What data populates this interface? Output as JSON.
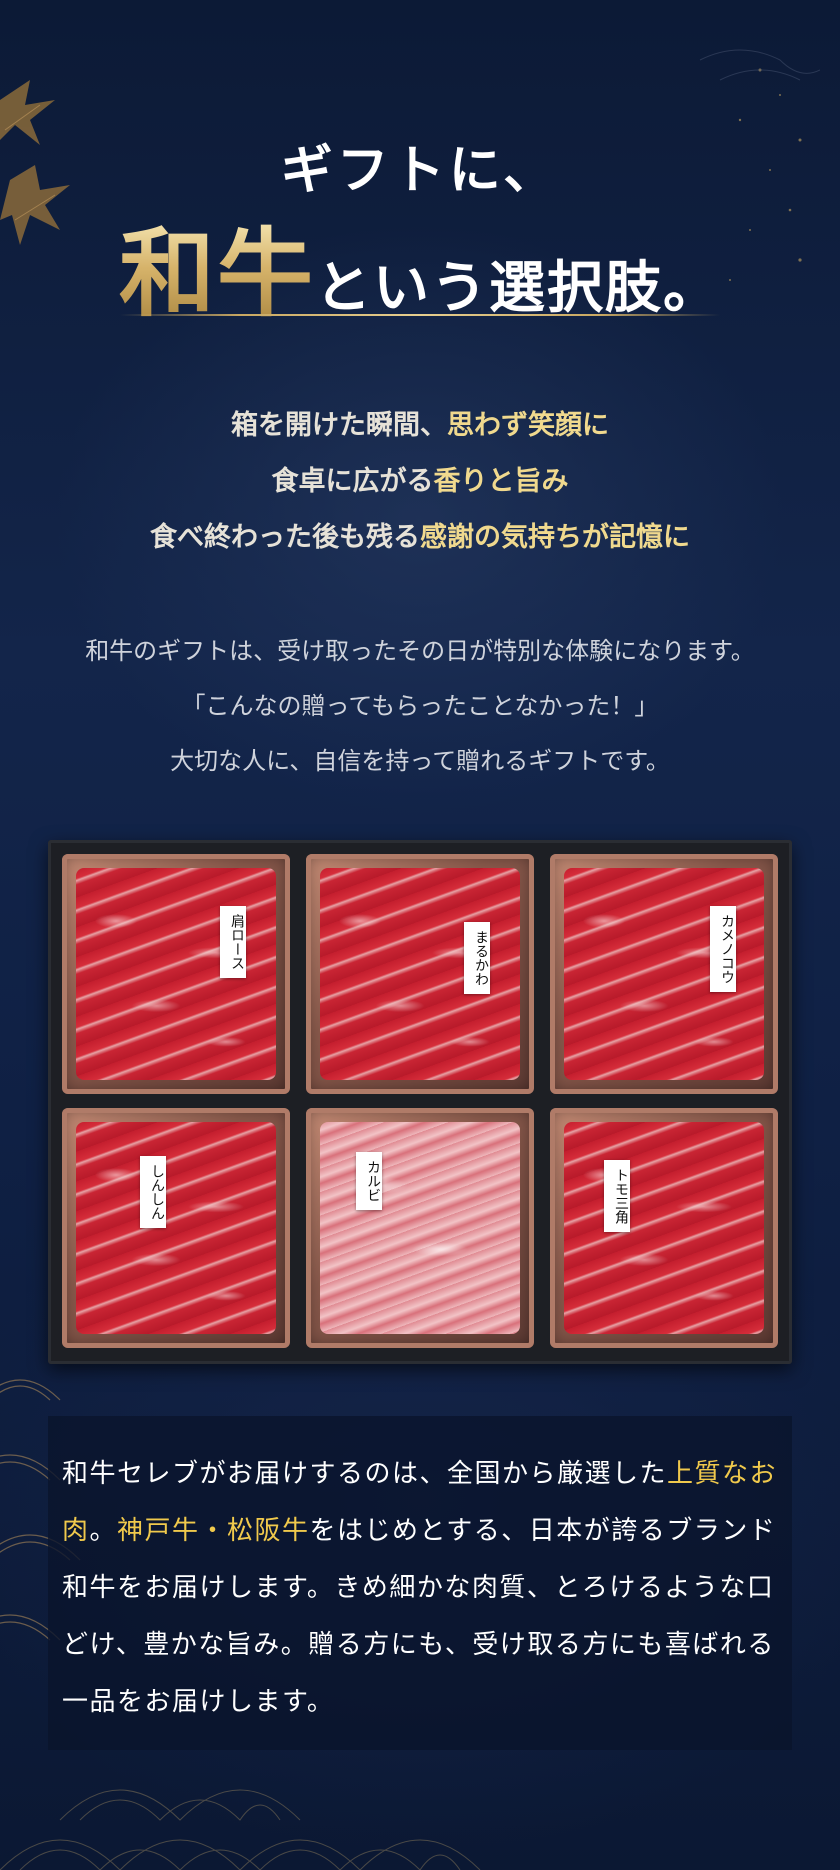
{
  "hero": {
    "line1": "ギフトに、",
    "big": "和牛",
    "rest": "という選択肢。"
  },
  "taglines": [
    {
      "plain": "箱を開けた瞬間、",
      "highlight": "思わず笑顔に"
    },
    {
      "plain": "食卓に広がる",
      "highlight": "香りと旨み"
    },
    {
      "plain": "食べ終わった後も残る",
      "highlight": "感謝の気持ちが記憶に"
    }
  ],
  "intro": [
    "和牛のギフトは、受け取ったその日が特別な体験になります。",
    "「こんなの贈ってもらったことなかった！」",
    "大切な人に、自信を持って贈れるギフトです。"
  ],
  "gift_labels": [
    "肩ロース",
    "まるかわ",
    "カメノコウ",
    "しんしん",
    "カルビ",
    "トモ三角"
  ],
  "description": {
    "part1": "和牛セレブがお届けするのは、全国から厳選した",
    "gold1": "上質なお肉",
    "part2": "。",
    "gold2": "神戸牛・松阪牛",
    "part3": "をはじめとする、日本が誇るブランド和牛をお届けします。きめ細かな肉質、とろけるような口どけ、豊かな旨み。贈る方にも、受け取る方にも喜ばれる一品をお届けします。"
  },
  "colors": {
    "background": "#0f1d3a",
    "gold_text": "#f0c94c",
    "highlight_text": "#f0d98e"
  }
}
